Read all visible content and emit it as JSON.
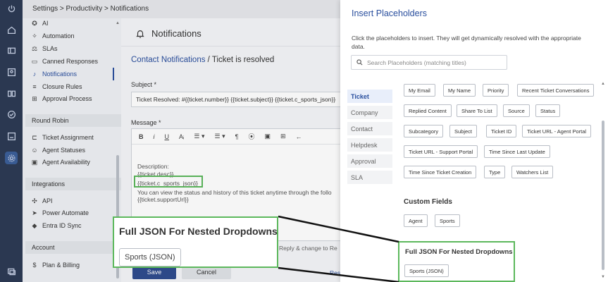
{
  "rail": {
    "icons": [
      "power-icon",
      "home-icon",
      "ticket-icon",
      "contact-icon",
      "knowledge-icon",
      "check-icon",
      "reports-icon",
      "settings-icon",
      "chat-icon"
    ]
  },
  "topbar": {
    "breadcrumb": "Settings > Productivity > Notifications"
  },
  "sidebar": {
    "items": [
      {
        "icon": "ai-icon",
        "glyph": "✪",
        "label": "AI"
      },
      {
        "icon": "automation-icon",
        "glyph": "✧",
        "label": "Automation"
      },
      {
        "icon": "sla-icon",
        "glyph": "⚖",
        "label": "SLAs"
      },
      {
        "icon": "canned-icon",
        "glyph": "▭",
        "label": "Canned Responses"
      },
      {
        "icon": "bell-icon",
        "glyph": "♪",
        "label": "Notifications"
      },
      {
        "icon": "closure-icon",
        "glyph": "≡",
        "label": "Closure Rules"
      },
      {
        "icon": "approval-icon",
        "glyph": "⊞",
        "label": "Approval Process"
      }
    ],
    "sections": {
      "round_robin": "Round Robin",
      "integrations": "Integrations",
      "account": "Account"
    },
    "round_robin_items": [
      {
        "icon": "assign-icon",
        "glyph": "⊏",
        "label": "Ticket Assignment"
      },
      {
        "icon": "agent-status-icon",
        "glyph": "☺",
        "label": "Agent Statuses"
      },
      {
        "icon": "availability-icon",
        "glyph": "▣",
        "label": "Agent Availability"
      }
    ],
    "integration_items": [
      {
        "icon": "api-icon",
        "glyph": "✣",
        "label": "API"
      },
      {
        "icon": "power-automate-icon",
        "glyph": "➤",
        "label": "Power Automate"
      },
      {
        "icon": "entra-icon",
        "glyph": "◆",
        "label": "Entra ID Sync"
      }
    ],
    "account_items": [
      {
        "icon": "billing-icon",
        "glyph": "$",
        "label": "Plan & Billing"
      }
    ]
  },
  "main": {
    "title": "Notifications",
    "crumb_link": "Contact Notifications",
    "crumb_rest": " / Ticket is resolved",
    "subject_label": "Subject *",
    "subject_value": "Ticket Resolved: #{{ticket.number}} {{ticket.subject}} {{ticket.c_sports_json}}",
    "message_label": "Message *",
    "toolbar": [
      "B",
      "i",
      "U",
      "Aᵢ",
      "☰ ▾",
      "☰ ▾",
      "¶",
      "⦿",
      "▣",
      "⊞",
      "←"
    ],
    "body_lines": [
      "Description:",
      "{{ticket.desc}}",
      "{{ticket.c_sports_json}}",
      "You can view the status and history of this ticket anytime through the follo",
      "{{ticket.supportUrl}}"
    ],
    "reply_text": "Reply & change to Re",
    "save_label": "Save",
    "cancel_label": "Cancel",
    "reset_label": "Rese"
  },
  "drawer": {
    "title": "Insert Placeholders",
    "description": "Click the placeholders to insert. They will get dynamically resolved with the appropriate data.",
    "search_placeholder": "Search Placeholders (matching titles)",
    "tabs": [
      "Ticket",
      "Company",
      "Contact",
      "Helpdesk",
      "Approval",
      "SLA"
    ],
    "active_tab": "Ticket",
    "chips": [
      "My Email",
      "My Name",
      "Priority",
      "Recent Ticket Conversations",
      "Replied Content",
      "Share To List",
      "Source",
      "Status",
      "Subcategory",
      "Subject",
      "Ticket ID",
      "Ticket URL - Agent Portal",
      "Ticket URL - Support Portal",
      "Time Since Last Update",
      "Time Since Ticket Creation",
      "Type",
      "Watchers List"
    ],
    "custom_fields_title": "Custom Fields",
    "custom_chips": [
      "Agent",
      "Sports"
    ],
    "nested_title": "Full JSON For Nested Dropdowns",
    "nested_chip": "Sports (JSON)"
  },
  "zoom": {
    "title": "Full JSON For Nested Dropdowns",
    "chip": "Sports (JSON)"
  },
  "colors": {
    "accent": "#2a4f9e",
    "highlight": "#5cb85c",
    "rail": "#2d3b55"
  }
}
